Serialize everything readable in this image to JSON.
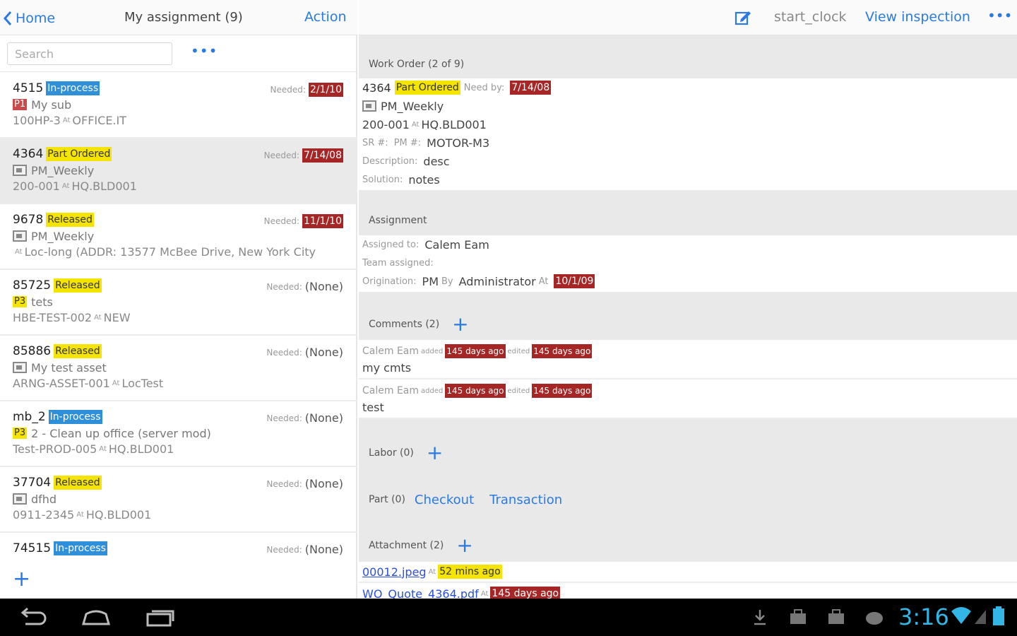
{
  "left_header": {
    "back_label": "Home",
    "title": "My assignment (9)",
    "action_label": "Action"
  },
  "search": {
    "placeholder": "Search",
    "more": "•••"
  },
  "list": [
    {
      "id": "4515",
      "status": "In-process",
      "status_color": "blue",
      "needed_label": "Needed:",
      "needed": "2/1/10",
      "priority": "P1",
      "asset": "My sub",
      "loc_prefix": "100HP-3",
      "at": "At",
      "location": "OFFICE.IT"
    },
    {
      "id": "4364",
      "status": "Part Ordered",
      "status_color": "yellow",
      "needed_label": "Needed:",
      "needed": "7/14/08",
      "priority": "PM",
      "asset": "PM_Weekly",
      "loc_prefix": "200-001",
      "at": "At",
      "location": "HQ.BLD001"
    },
    {
      "id": "9678",
      "status": "Released",
      "status_color": "yellow",
      "needed_label": "Needed:",
      "needed": "11/1/10",
      "priority": "PM",
      "asset": "PM_Weekly",
      "loc_prefix": "",
      "at": "At",
      "location": "Loc-long (ADDR: 13577 McBee Drive, New York City"
    },
    {
      "id": "85725",
      "status": "Released",
      "status_color": "yellow",
      "needed_label": "Needed:",
      "needed": "(None)",
      "priority": "P3",
      "asset": "tets",
      "loc_prefix": "HBE-TEST-002",
      "at": "At",
      "location": "NEW"
    },
    {
      "id": "85886",
      "status": "Released",
      "status_color": "yellow",
      "needed_label": "Needed:",
      "needed": "(None)",
      "priority": "PM",
      "asset": "My test asset",
      "loc_prefix": "ARNG-ASSET-001",
      "at": "At",
      "location": "LocTest"
    },
    {
      "id": "mb_2",
      "status": "In-process",
      "status_color": "blue",
      "needed_label": "Needed:",
      "needed": "(None)",
      "priority": "P3",
      "asset": "2 - Clean up office (server mod)",
      "loc_prefix": "Test-PROD-005",
      "at": "At",
      "location": "HQ.BLD001"
    },
    {
      "id": "37704",
      "status": "Released",
      "status_color": "yellow",
      "needed_label": "Needed:",
      "needed": "(None)",
      "priority": "PM",
      "asset": "dfhd",
      "loc_prefix": "0911-2345",
      "at": "At",
      "location": "HQ.BLD001"
    },
    {
      "id": "74515",
      "status": "In-process",
      "status_color": "blue",
      "needed_label": "Needed:",
      "needed": "(None)",
      "priority": "",
      "asset": "",
      "loc_prefix": "",
      "at": "",
      "location": ""
    }
  ],
  "add_label": "+",
  "right_header": {
    "clock_label": "start_clock",
    "view_label": "View inspection",
    "more": "•••"
  },
  "work_order": {
    "section": "Work Order (2 of 9)",
    "id": "4364",
    "status": "Part Ordered",
    "need_by_label": "Need by:",
    "need_by": "7/14/08",
    "asset": "PM_Weekly",
    "loc_prefix": "200-001",
    "at": "At",
    "location": "HQ.BLD001",
    "sr_label": "SR #:",
    "pm_label": "PM #:",
    "pm_value": "MOTOR-M3",
    "desc_label": "Description:",
    "desc": "desc",
    "solution_label": "Solution:",
    "solution": "notes"
  },
  "assignment": {
    "section": "Assignment",
    "assigned_label": "Assigned to:",
    "assigned": "Calem Eam",
    "team_label": "Team assigned:",
    "orig_label": "Origination:",
    "orig": "PM",
    "by_label": "By",
    "by": "Administrator",
    "at_label": "At",
    "date": "10/1/09"
  },
  "comments": {
    "section": "Comments (2)",
    "items": [
      {
        "author": "Calem Eam",
        "added_label": "added",
        "added": "145 days ago",
        "edited_label": "edited",
        "edited": "145 days ago",
        "text": "my cmts"
      },
      {
        "author": "Calem Eam",
        "added_label": "added",
        "added": "145 days ago",
        "edited_label": "edited",
        "edited": "145 days ago",
        "text": "test"
      }
    ]
  },
  "labor": {
    "section": "Labor (0)"
  },
  "part": {
    "section": "Part (0)",
    "checkout": "Checkout",
    "transaction": "Transaction"
  },
  "attachment": {
    "section": "Attachment (2)",
    "items": [
      {
        "name": "00012.jpeg",
        "at": "At",
        "when": "52 mins ago",
        "color": "yellow"
      },
      {
        "name": "WO_Quote_4364.pdf",
        "at": "At",
        "when": "145 days ago",
        "color": "red"
      }
    ]
  },
  "system": {
    "time": "3:16"
  },
  "colors": {
    "accent": "#2a7ae4",
    "yellow_badge": "#f5e400",
    "red_badge": "#a62525",
    "blue_badge": "#2f8fd8",
    "clock": "#33b5e5"
  }
}
